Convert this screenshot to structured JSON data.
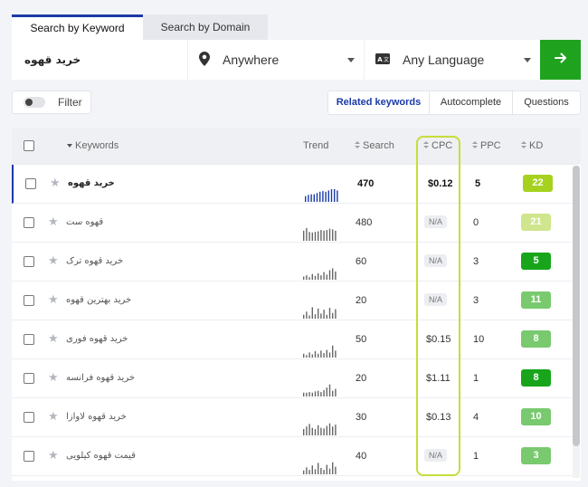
{
  "tabs": [
    {
      "label": "Search by Keyword",
      "active": true
    },
    {
      "label": "Search by Domain",
      "active": false
    }
  ],
  "search": {
    "keyword": "خرید قهوه",
    "location": "Anywhere",
    "language": "Any Language",
    "location_icon": "map-pin-icon",
    "language_icon": "translate-icon",
    "go_icon": "arrow-right-icon"
  },
  "filter": {
    "label": "Filter"
  },
  "views": [
    {
      "label": "Related keywords",
      "active": true
    },
    {
      "label": "Autocomplete",
      "active": false
    },
    {
      "label": "Questions",
      "active": false
    }
  ],
  "columns": {
    "keywords": "Keywords",
    "trend": "Trend",
    "search": "Search",
    "cpc": "CPC",
    "ppc": "PPC",
    "kd": "KD"
  },
  "colors": {
    "accent": "#1a3aa8",
    "go": "#1fa31f",
    "highlight": "#c6dd3a",
    "trend_active": "#1a3aa8",
    "trend": "#666666"
  },
  "rows": [
    {
      "keyword": "خرید قهوه",
      "trend": [
        0.45,
        0.55,
        0.6,
        0.6,
        0.7,
        0.8,
        0.85,
        0.8,
        0.9,
        1.0,
        1.0,
        0.9
      ],
      "search": "470",
      "cpc": "$0.12",
      "ppc": "5",
      "kd": "22",
      "kd_color": "#a6d21f"
    },
    {
      "keyword": "قهوه ست",
      "trend": [
        0.8,
        1.0,
        0.7,
        0.65,
        0.7,
        0.75,
        0.85,
        0.8,
        0.85,
        0.95,
        0.9,
        0.8
      ],
      "search": "480",
      "cpc": "N/A",
      "ppc": "0",
      "kd": "21",
      "kd_color": "#cfe58e"
    },
    {
      "keyword": "خرید قهوه ترک",
      "trend": [
        0.25,
        0.35,
        0.2,
        0.45,
        0.3,
        0.5,
        0.35,
        0.6,
        0.4,
        0.75,
        0.9,
        0.65
      ],
      "search": "60",
      "cpc": "N/A",
      "ppc": "3",
      "kd": "5",
      "kd_color": "#18a51c"
    },
    {
      "keyword": "خرید بهترین قهوه",
      "trend": [
        0.3,
        0.55,
        0.25,
        0.9,
        0.35,
        0.8,
        0.4,
        0.7,
        0.3,
        0.85,
        0.45,
        0.75
      ],
      "search": "20",
      "cpc": "N/A",
      "ppc": "3",
      "kd": "11",
      "kd_color": "#79c96f"
    },
    {
      "keyword": "خرید قهوه فوری",
      "trend": [
        0.3,
        0.2,
        0.4,
        0.25,
        0.5,
        0.3,
        0.55,
        0.35,
        0.6,
        0.4,
        0.95,
        0.55
      ],
      "search": "50",
      "cpc": "$0.15",
      "ppc": "10",
      "kd": "8",
      "kd_color": "#79c96f"
    },
    {
      "keyword": "خرید قهوه فرانسه",
      "trend": [
        0.3,
        0.3,
        0.35,
        0.3,
        0.4,
        0.45,
        0.35,
        0.5,
        0.7,
        0.95,
        0.45,
        0.6
      ],
      "search": "20",
      "cpc": "$1.11",
      "ppc": "1",
      "kd": "8",
      "kd_color": "#18a51c"
    },
    {
      "keyword": "خرید قهوه لاوازا",
      "trend": [
        0.5,
        0.7,
        0.9,
        0.6,
        0.5,
        0.8,
        0.6,
        0.55,
        0.75,
        0.95,
        0.7,
        0.85
      ],
      "search": "30",
      "cpc": "$0.13",
      "ppc": "4",
      "kd": "10",
      "kd_color": "#79c96f"
    },
    {
      "keyword": "قیمت قهوه کیلویی",
      "trend": [
        0.3,
        0.55,
        0.35,
        0.7,
        0.4,
        0.9,
        0.5,
        0.35,
        0.75,
        0.45,
        0.95,
        0.6
      ],
      "search": "40",
      "cpc": "N/A",
      "ppc": "1",
      "kd": "3",
      "kd_color": "#79c96f"
    }
  ]
}
